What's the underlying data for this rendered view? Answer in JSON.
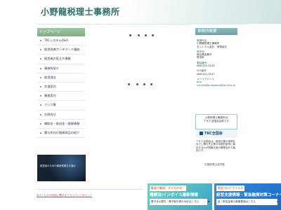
{
  "header": {
    "title": "小野龍税理士事務所"
  },
  "sidebar": {
    "heading": "トップページ",
    "items": [
      {
        "label": "TKCシステムQ&A"
      },
      {
        "label": "経営改善オンデマンド講座"
      },
      {
        "label": "経営者お役立ち情報"
      },
      {
        "label": "事務所紹介"
      },
      {
        "label": "経営理念"
      },
      {
        "label": "交通案内"
      },
      {
        "label": "業務案内"
      },
      {
        "label": "リンク集"
      },
      {
        "label": "お問合せ"
      },
      {
        "label": "補助金・助成金・融資情報"
      },
      {
        "label": "関与先向け融資商品の紹介"
      }
    ],
    "banner_text": "経営者のための最新情報をお届け"
  },
  "office": {
    "heading": "事務所概要",
    "name_label": "事務所名",
    "name_lines": [
      "小野龍税理士事務所",
      "セントラル会計　荷物会社"
    ],
    "address_label": "所在地",
    "address_lines": [
      "岡山県倉敷市",
      "笹沖町"
    ],
    "tel_label": "電話番号",
    "tel": "086-422-3133",
    "fax_label": "FAX番号",
    "fax": "086-422-3147",
    "email_label": "メールアドレス",
    "email": "ono-central@onosanpo@tkcnf.or.jp"
  },
  "tkc": {
    "box_lines": [
      "小野税理士事務所は",
      "ＴＫＣ全国会会員です"
    ],
    "logo": "TKC全国会",
    "description": "ＴＫＣ全国会は、租税正義の実現をめざし関与先企業の永続的繁栄に奉仕するわが国最大級の職業会計人集団です。",
    "caption": "中国税理士会所属"
  },
  "footer": {
    "link": "本サービスの利用に関するプライバシーポリシー"
  },
  "ads": [
    {
      "tag": "動画で解説！すぐわかる！",
      "title": "電帳法/インボイス最新情報",
      "link": "電子化の要件・電子取引等の対応はこちら"
    },
    {
      "tag": "新型コロナウイルス",
      "title": "経営支援情報・緊急融資対策コーナー",
      "link": "金・助成金等の募集要項はこちら"
    }
  ]
}
